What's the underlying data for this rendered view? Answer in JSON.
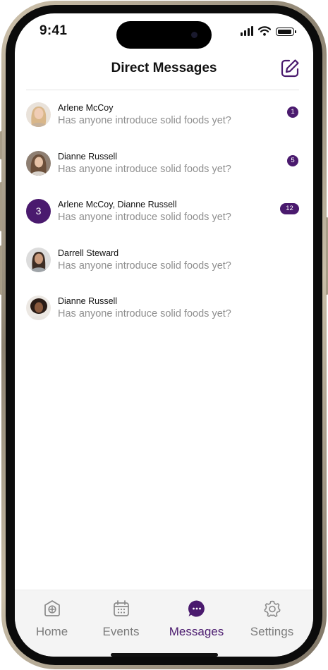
{
  "status_bar": {
    "time": "9:41"
  },
  "header": {
    "title": "Direct Messages"
  },
  "messages": [
    {
      "name": "Arlene McCoy",
      "preview": "Has anyone introduce solid foods yet?",
      "badge": "1",
      "avatar": "avatar-photo"
    },
    {
      "name": "Dianne Russell",
      "preview": "Has anyone introduce solid foods yet?",
      "badge": "5",
      "avatar": "avatar-photo"
    },
    {
      "name": "Arlene McCoy, Dianne Russell",
      "preview": "Has anyone introduce solid foods yet?",
      "badge": "12",
      "avatar_count": "3"
    },
    {
      "name": "Darrell Steward",
      "preview": "Has anyone introduce solid foods yet?",
      "badge": "",
      "avatar": "avatar-photo"
    },
    {
      "name": "Dianne Russell",
      "preview": "Has anyone introduce solid foods yet?",
      "badge": "",
      "avatar": "avatar-photo"
    }
  ],
  "tabs": [
    {
      "label": "Home",
      "icon": "home-icon",
      "active": false
    },
    {
      "label": "Events",
      "icon": "calendar-icon",
      "active": false
    },
    {
      "label": "Messages",
      "icon": "chat-bubble-icon",
      "active": true
    },
    {
      "label": "Settings",
      "icon": "gear-icon",
      "active": false
    }
  ],
  "colors": {
    "accent": "#4a1a6e",
    "muted_text": "#8f8f8f",
    "tab_inactive": "#7c7c7c"
  }
}
